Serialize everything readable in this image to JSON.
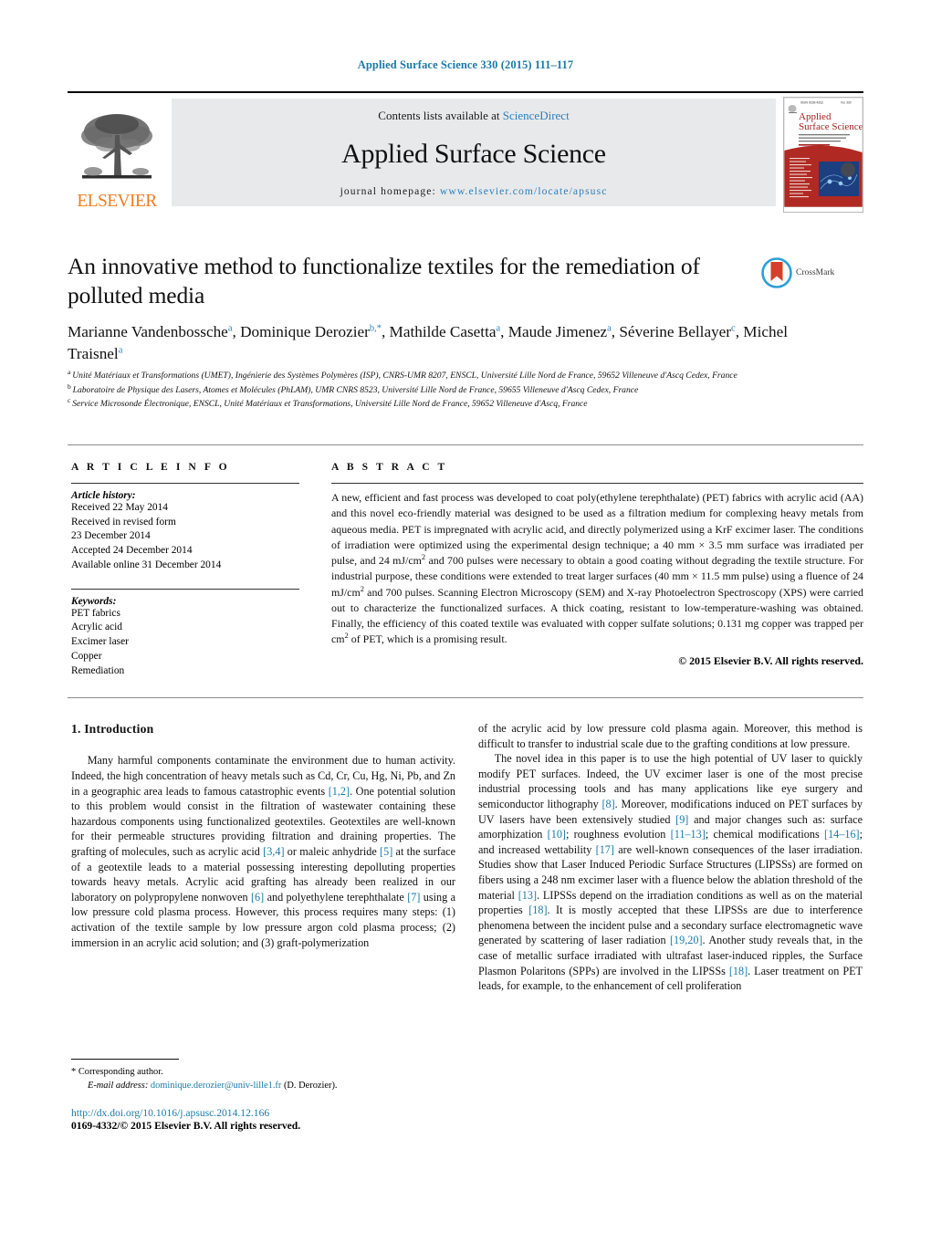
{
  "running_head": "Applied Surface Science 330 (2015) 111–117",
  "masthead": {
    "publisher_name": "ELSEVIER",
    "contents_prefix": "Contents lists available at",
    "contents_link": "ScienceDirect",
    "journal_name": "Applied Surface Science",
    "homepage_prefix": "journal homepage:",
    "homepage_url": "www.elsevier.com/locate/apsusc",
    "cover": {
      "title_line1": "Applied",
      "title_line2": "Surface Science",
      "top_left_label": "ISSN 0169-4332",
      "top_right_label": "Vol. 330  2015"
    }
  },
  "article": {
    "title": "An innovative method to functionalize textiles for the remediation of polluted media",
    "crossmark_label": "CrossMark",
    "authors": [
      {
        "name": "Marianne Vandenbossche",
        "marks": "a",
        "sep": ", "
      },
      {
        "name": "Dominique Derozier",
        "marks": "b,*",
        "sep": ", "
      },
      {
        "name": "Mathilde Casetta",
        "marks": "a",
        "sep": ", "
      },
      {
        "name": "Maude Jimenez",
        "marks": "a",
        "sep": ", "
      },
      {
        "name": "Séverine Bellayer",
        "marks": "c",
        "sep": ", "
      },
      {
        "name": "Michel Traisnel",
        "marks": "a",
        "sep": ""
      }
    ],
    "affiliations": [
      {
        "mark": "a",
        "text": "Unité Matériaux et Transformations (UMET), Ingénierie des Systèmes Polymères (ISP), CNRS-UMR 8207, ENSCL, Université Lille Nord de France, 59652 Villeneuve d'Ascq Cedex, France"
      },
      {
        "mark": "b",
        "text": "Laboratoire de Physique des Lasers, Atomes et Molécules (PhLAM), UMR CNRS 8523, Université Lille Nord de France, 59655 Villeneuve d'Ascq Cedex, France"
      },
      {
        "mark": "c",
        "text": "Service Microsonde Électronique, ENSCL, Unité Matériaux et Transformations, Université Lille Nord de France, 59652 Villeneuve d'Ascq, France"
      }
    ]
  },
  "article_info": {
    "heading": "A R T I C L E   I N F O",
    "history_label": "Article history:",
    "history_lines": [
      "Received 22 May 2014",
      "Received in revised form",
      "23 December 2014",
      "Accepted 24 December 2014",
      "Available online 31 December 2014"
    ],
    "keywords_label": "Keywords:",
    "keywords": [
      "PET fabrics",
      "Acrylic acid",
      "Excimer laser",
      "Copper",
      "Remediation"
    ]
  },
  "abstract": {
    "heading": "A B S T R A C T",
    "paragraphs": [
      "A new, efficient and fast process was developed to coat poly(ethylene terephthalate) (PET) fabrics with acrylic acid (AA) and this novel eco-friendly material was designed to be used as a filtration medium for complexing heavy metals from aqueous media. PET is impregnated with acrylic acid, and directly polymerized using a KrF excimer laser. The conditions of irradiation were optimized using the experimental design technique; a 40 mm × 3.5 mm surface was irradiated per pulse, and 24 mJ/cm2 and 700 pulses were necessary to obtain a good coating without degrading the textile structure. For industrial purpose, these conditions were extended to treat larger surfaces (40 mm × 11.5 mm pulse) using a fluence of 24 mJ/cm2 and 700 pulses. Scanning Electron Microscopy (SEM) and X-ray Photoelectron Spectroscopy (XPS) were carried out to characterize the functionalized surfaces. A thick coating, resistant to low-temperature-washing was obtained. Finally, the efficiency of this coated textile was evaluated with copper sulfate solutions; 0.131 mg copper was trapped per cm2 of PET, which is a promising result."
    ],
    "copyright": "© 2015 Elsevier B.V. All rights reserved."
  },
  "body": {
    "section_heading": "1.  Introduction",
    "left_column": [
      "Many harmful components contaminate the environment due to human activity. Indeed, the high concentration of heavy metals such as Cd, Cr, Cu, Hg, Ni, Pb, and Zn in a geographic area leads to famous catastrophic events [1,2]. One potential solution to this problem would consist in the filtration of wastewater containing these hazardous components using functionalized geotextiles. Geotextiles are well-known for their permeable structures providing filtration and draining properties. The grafting of molecules, such as acrylic acid [3,4] or maleic anhydride [5] at the surface of a geotextile leads to a material possessing interesting depolluting properties towards heavy metals. Acrylic acid grafting has already been realized in our laboratory on polypropylene nonwoven [6] and polyethylene terephthalate [7] using a low pressure cold plasma process. However, this process requires many steps: (1) activation of the textile sample by low pressure argon cold plasma process; (2) immersion in an acrylic acid solution; and (3) graft-polymerization"
    ],
    "right_column": [
      "of the acrylic acid by low pressure cold plasma again. Moreover, this method is difficult to transfer to industrial scale due to the grafting conditions at low pressure.",
      "The novel idea in this paper is to use the high potential of UV laser to quickly modify PET surfaces. Indeed, the UV excimer laser is one of the most precise industrial processing tools and has many applications like eye surgery and semiconductor lithography [8]. Moreover, modifications induced on PET surfaces by UV lasers have been extensively studied [9] and major changes such as: surface amorphization [10]; roughness evolution [11–13]; chemical modifications [14–16]; and increased wettability [17] are well-known consequences of the laser irradiation. Studies show that Laser Induced Periodic Surface Structures (LIPSSs) are formed on fibers using a 248 nm excimer laser with a fluence below the ablation threshold of the material [13]. LIPSSs depend on the irradiation conditions as well as on the material properties [18]. It is mostly accepted that these LIPSSs are due to interference phenomena between the incident pulse and a secondary surface electromagnetic wave generated by scattering of laser radiation [19,20]. Another study reveals that, in the case of metallic surface irradiated with ultrafast laser-induced ripples, the Surface Plasmon Polaritons (SPPs) are involved in the LIPSSs [18]. Laser treatment on PET leads, for example, to the enhancement of cell proliferation"
    ]
  },
  "footer": {
    "corresponding_marker": "*",
    "corresponding_text": "Corresponding author.",
    "email_label": "E-mail address:",
    "email": "dominique.derozier@univ-lille1.fr",
    "email_suffix": "(D. Derozier).",
    "doi_url": "http://dx.doi.org/10.1016/j.apsusc.2014.12.166",
    "issn_line": "0169-4332/© 2015 Elsevier B.V. All rights reserved."
  },
  "colors": {
    "link_blue": "#1a7aa8",
    "elsevier_orange": "#ef7d21",
    "band_gray": "#e8e9ea"
  }
}
